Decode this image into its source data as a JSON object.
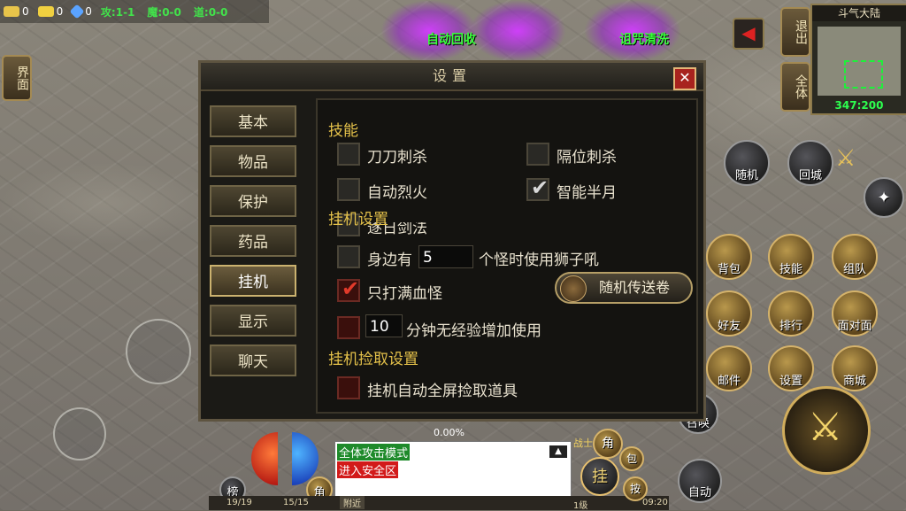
{
  "hud": {
    "resources": [
      {
        "icon": "gold-bars-icon",
        "value": "0",
        "color": "#e8c44a"
      },
      {
        "icon": "gold-ingot-icon",
        "value": "0",
        "color": "#f0d040"
      },
      {
        "icon": "diamond-icon",
        "value": "0",
        "color": "#5aa3ff"
      }
    ],
    "stats": [
      "攻:1-1",
      "魔:0-0",
      "道:0-0"
    ],
    "auto_recycle": "自动回收",
    "curse_clean": "诅咒清洗",
    "left_button": "界面",
    "exit_button": "退出",
    "all_button": "全体",
    "minimap": {
      "title": "斗气大陆",
      "coord": "347:200"
    }
  },
  "dialog": {
    "title": "设置",
    "close": "✕",
    "tabs": [
      "基本",
      "物品",
      "保护",
      "药品",
      "挂机",
      "显示",
      "聊天"
    ],
    "active_tab": "挂机",
    "section_skills": "技能",
    "skill_opts": [
      {
        "label": "刀刀刺杀",
        "checked": false
      },
      {
        "label": "隔位刺杀",
        "checked": false
      },
      {
        "label": "自动烈火",
        "checked": false
      },
      {
        "label": "智能半月",
        "checked": true
      },
      {
        "label": "逐日剑法",
        "checked": false
      }
    ],
    "section_afk": "挂机设置",
    "lion_prefix": "身边有",
    "lion_value": "5",
    "lion_suffix": "个怪时使用狮子吼",
    "full_hp": "只打满血怪",
    "full_hp_checked": true,
    "minutes_value": "10",
    "minutes_label": "分钟无经验增加使用",
    "random_scroll": "随机传送卷",
    "section_pickup": "挂机捡取设置",
    "pickup_label": "挂机自动全屏捡取道具"
  },
  "side_buttons": {
    "random": "随机",
    "return": "回城",
    "bag": "背包",
    "skill": "技能",
    "team": "组队",
    "friend": "好友",
    "rank": "排行",
    "face": "面对面",
    "mail": "邮件",
    "settings": "设置",
    "shop": "商城",
    "summon": "召唤",
    "auto": "自动"
  },
  "bottom": {
    "hp": "19/19",
    "mp": "15/15",
    "exp": "0.00%",
    "role_btn": "角",
    "rank_btn": "榜",
    "chat_line1": "全体攻击模式",
    "chat_line2": "进入安全区",
    "nearby": "附近",
    "class_label": "战士",
    "level": "1级",
    "time": "09:20",
    "role_btn2": "角",
    "bag_btn": "包",
    "afk_btn": "挂",
    "key_btn": "按"
  }
}
